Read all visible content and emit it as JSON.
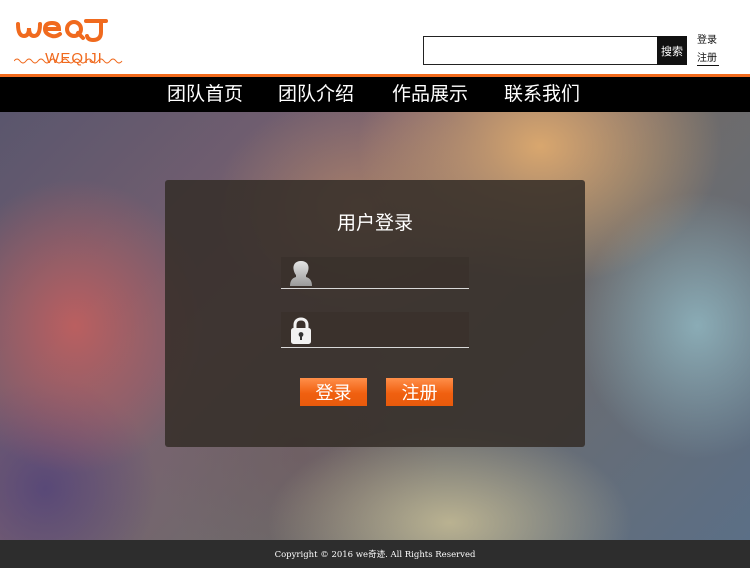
{
  "brand": {
    "logo_text": "WEQIJI",
    "logo_mark": "weqj-logo-mark",
    "color": "#f26b1d"
  },
  "search": {
    "placeholder": "",
    "value": "",
    "button_label": "搜索"
  },
  "header_links": {
    "login": "登录",
    "register": "注册"
  },
  "nav": {
    "items": [
      {
        "label": "团队首页"
      },
      {
        "label": "团队介绍"
      },
      {
        "label": "作品展示"
      },
      {
        "label": "联系我们"
      }
    ]
  },
  "login_form": {
    "title": "用户登录",
    "username": {
      "value": "",
      "placeholder": "",
      "icon": "user-icon"
    },
    "password": {
      "value": "",
      "placeholder": "",
      "icon": "lock-icon"
    },
    "login_button": "登录",
    "register_button": "注册"
  },
  "footer": {
    "text": "Copyright © 2016 we奇迹. All Rights Reserved"
  },
  "colors": {
    "accent": "#f26b1d",
    "nav_bg": "#000000",
    "footer_bg": "#2d2d2d"
  }
}
